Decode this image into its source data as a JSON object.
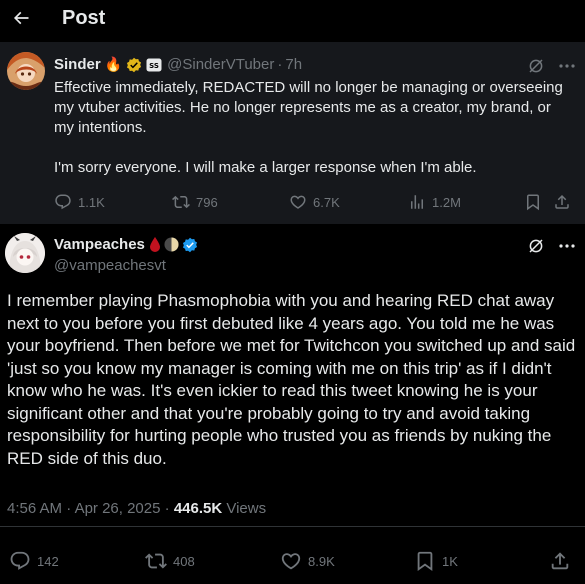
{
  "header": {
    "title": "Post",
    "back_icon": "arrow-left-icon"
  },
  "quoted_post": {
    "author_name": "Sinder",
    "author_emoji": "🔥",
    "handle": "@SinderVTuber",
    "separator": "·",
    "time": "7h",
    "body_line1": "Effective immediately, REDACTED will no longer be managing or overseeing my vtuber activities. He no longer represents me as a creator, my brand, or my intentions.",
    "body_line2": "I'm sorry everyone. I will make a larger response when I'm able.",
    "stats": {
      "replies": "1.1K",
      "reposts": "796",
      "likes": "6.7K",
      "views": "1.2M"
    }
  },
  "main_post": {
    "author_name": "Vampeaches",
    "handle": "@vampeachesvt",
    "body": "I remember playing Phasmophobia with you and hearing RED chat away next to you before you first debuted like 4 years ago. You told me he was your boyfriend. Then before we met for Twitchcon you switched up and said 'just so you know my manager is coming with me on this trip' as if I didn't know who he was. It's even ickier to read this tweet knowing he is your significant other and that you're probably going to try and avoid taking responsibility for hurting people who trusted you as friends by nuking the RED side of this duo.",
    "time": "4:56 AM",
    "separator": "·",
    "date": "Apr 26, 2025",
    "separator2": "·",
    "views_count": "446.5K",
    "views_label": "Views",
    "stats": {
      "replies": "142",
      "reposts": "408",
      "likes": "8.9K",
      "bookmarks": "1K"
    }
  },
  "colors": {
    "background": "#000000",
    "quoted_background": "#16181c",
    "text": "#e7e9ea",
    "muted": "#71767b",
    "verified": "#1d9bf0",
    "gold_badge": "#e2b719"
  }
}
